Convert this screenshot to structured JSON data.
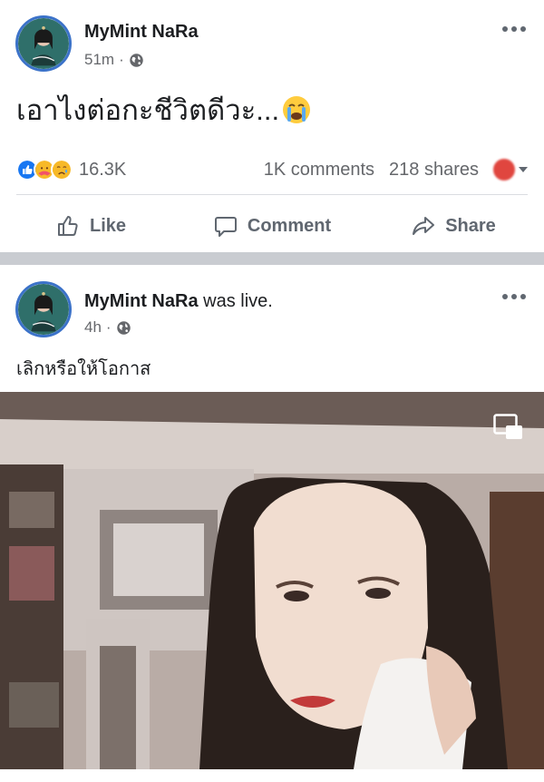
{
  "posts": [
    {
      "author": "MyMint NaRa",
      "author_suffix": "",
      "time": "51m",
      "separator": "·",
      "text": "เอาไงต่อกะชีวิตดีวะ...",
      "reactions_count": "16.3K",
      "comments": "1K comments",
      "shares": "218 shares",
      "actions": {
        "like": "Like",
        "comment": "Comment",
        "share": "Share"
      }
    },
    {
      "author": "MyMint NaRa",
      "author_suffix": " was live.",
      "time": "4h",
      "separator": "·",
      "text": "เลิกหรือให้โอกาส"
    }
  ],
  "icons": {
    "reactions": [
      "like-reaction-icon",
      "love-reaction-icon",
      "sad-reaction-icon"
    ],
    "globe": "globe-icon",
    "more": "more-options-icon",
    "pip": "picture-in-picture-icon"
  },
  "colors": {
    "like_blue": "#1877f2",
    "text": "#1c1e21",
    "secondary": "#65676b",
    "divider_band": "#c9ccd1"
  }
}
